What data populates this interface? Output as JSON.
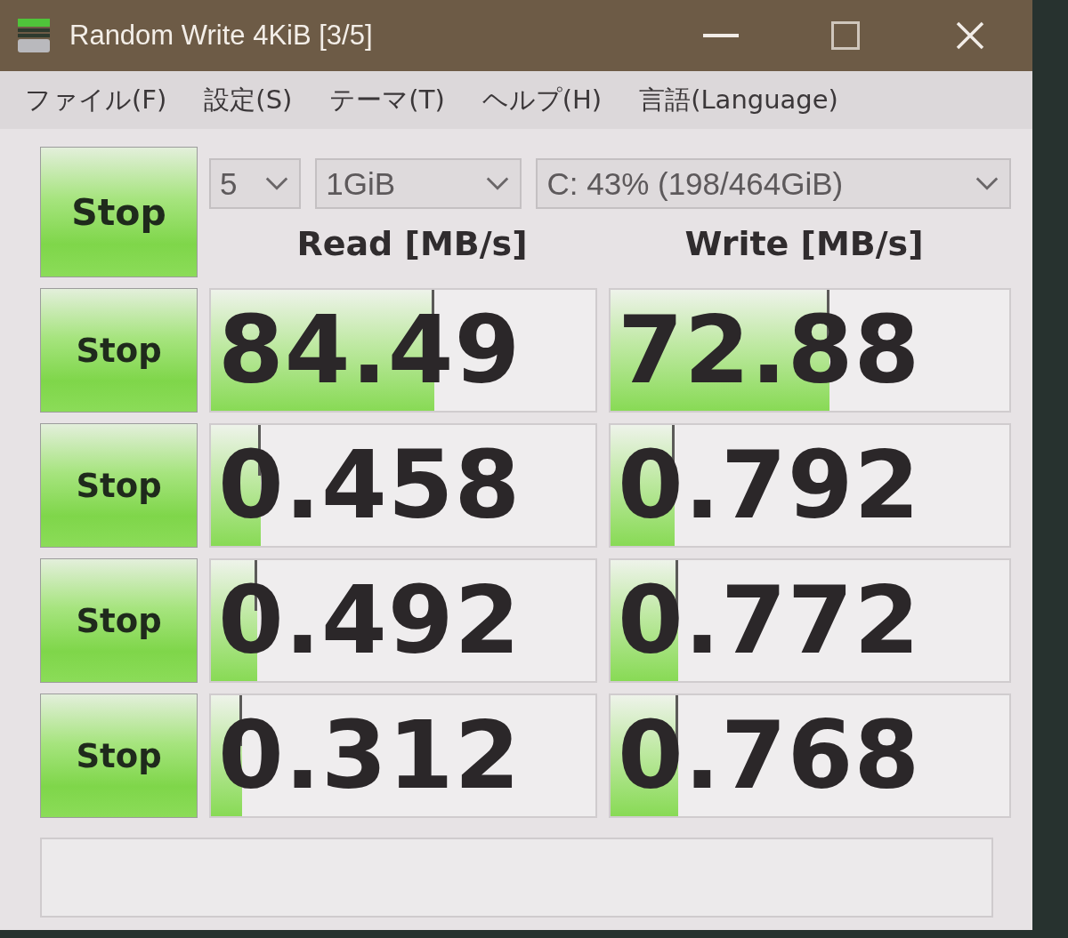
{
  "window": {
    "title": "Random Write 4KiB [3/5]"
  },
  "menu": [
    "ファイル(F)",
    "設定(S)",
    "テーマ(T)",
    "ヘルプ(H)",
    "言語(Language)"
  ],
  "controls": {
    "all_button": "Stop",
    "count": "5",
    "size": "1GiB",
    "drive": "C: 43% (198/464GiB)"
  },
  "columns": [
    "Read [MB/s]",
    "Write [MB/s]"
  ],
  "rows": [
    {
      "button": "Stop",
      "read": {
        "value": "84.49",
        "level": 0.58
      },
      "write": {
        "value": "72.88",
        "level": 0.55
      }
    },
    {
      "button": "Stop",
      "read": {
        "value": "0.458",
        "level": 0.13
      },
      "write": {
        "value": "0.792",
        "level": 0.16
      }
    },
    {
      "button": "Stop",
      "read": {
        "value": "0.492",
        "level": 0.12
      },
      "write": {
        "value": "0.772",
        "level": 0.17
      }
    },
    {
      "button": "Stop",
      "read": {
        "value": "0.312",
        "level": 0.08
      },
      "write": {
        "value": "0.768",
        "level": 0.17
      }
    }
  ]
}
